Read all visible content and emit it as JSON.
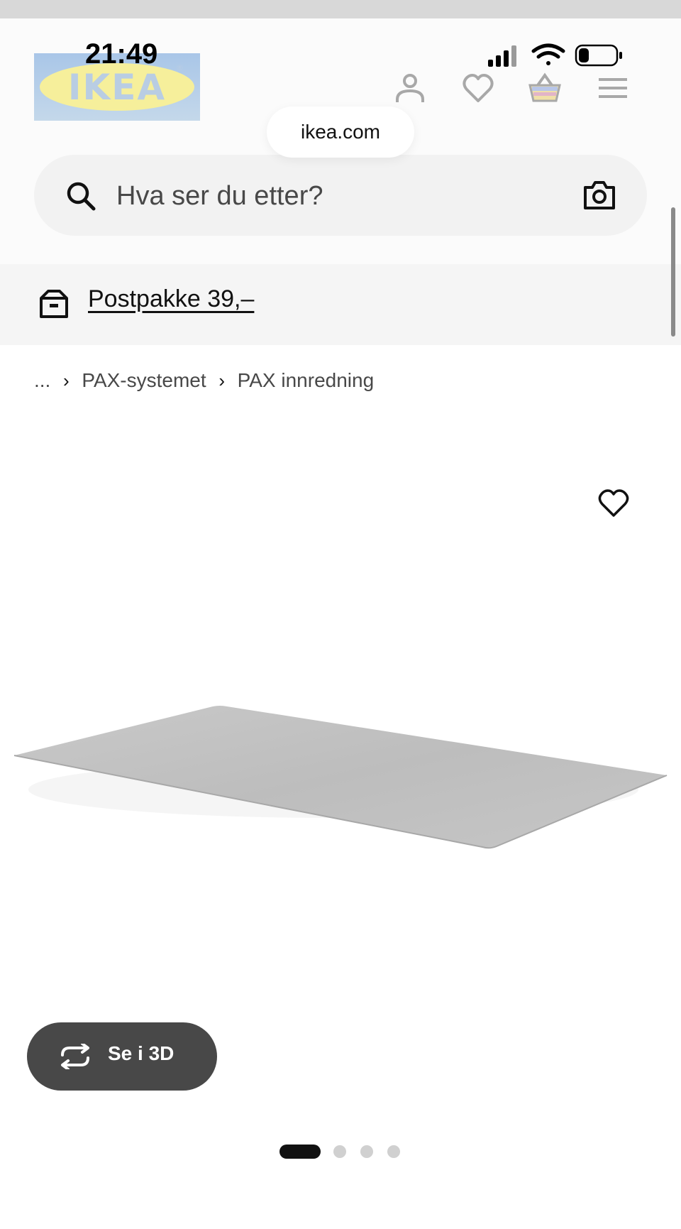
{
  "status_bar": {
    "time": "21:49"
  },
  "header": {
    "logo_text": "IKEA",
    "logo_reg": "®",
    "url": "ikea.com",
    "icons": [
      "profile-icon",
      "heart-icon",
      "basket-icon",
      "menu-icon"
    ]
  },
  "search": {
    "placeholder": "Hva ser du etter?"
  },
  "delivery": {
    "label": "Postpakke 39,–"
  },
  "breadcrumb": {
    "items": [
      "...",
      "PAX-systemet",
      "PAX innredning"
    ]
  },
  "product": {
    "view_3d_label": "Se i 3D",
    "image_count": 4,
    "active_image": 1
  },
  "colors": {
    "dark_button": "#484848",
    "search_bg": "#f2f2f2",
    "banner_bg": "#f5f5f5"
  }
}
